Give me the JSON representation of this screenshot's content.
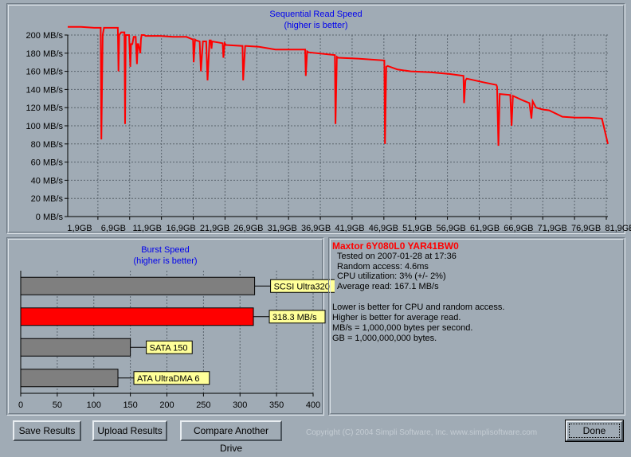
{
  "read_chart": {
    "title": "Sequential Read Speed",
    "subtitle": "(higher is better)",
    "y_ticks": [
      "200 MB/s",
      "180 MB/s",
      "160 MB/s",
      "140 MB/s",
      "120 MB/s",
      "100 MB/s",
      "80 MB/s",
      "60 MB/s",
      "40 MB/s",
      "20 MB/s",
      "0 MB/s"
    ],
    "x_ticks": [
      "1,9GB",
      "6,9GB",
      "11,9GB",
      "16,9GB",
      "21,9GB",
      "26,9GB",
      "31,9GB",
      "36,9GB",
      "41,9GB",
      "46,9GB",
      "51,9GB",
      "56,9GB",
      "61,9GB",
      "66,9GB",
      "71,9GB",
      "76,9GB",
      "81,9GB"
    ]
  },
  "burst_chart": {
    "title": "Burst Speed",
    "subtitle": "(higher is better)",
    "x_ticks": [
      "0",
      "50",
      "100",
      "150",
      "200",
      "250",
      "300",
      "350",
      "400"
    ],
    "bars": [
      {
        "label": "SCSI Ultra320",
        "highlight": false
      },
      {
        "label": "318.3 MB/s",
        "highlight": true
      },
      {
        "label": "SATA 150",
        "highlight": false
      },
      {
        "label": "ATA UltraDMA 6",
        "highlight": false
      }
    ]
  },
  "info": {
    "drive_name": "Maxtor 6Y080L0 YAR41BW0",
    "tested_on": "Tested on 2007-01-28 at 17:36",
    "random_access": "Random access: 4.6ms",
    "cpu_utilization": "CPU utilization: 3% (+/- 2%)",
    "average_read": "Average read: 167.1 MB/s",
    "note1": "Lower is better for CPU and random access.",
    "note2": "Higher is better for average read.",
    "note3": "MB/s = 1,000,000 bytes per second.",
    "note4": "GB = 1,000,000,000 bytes."
  },
  "buttons": {
    "save": "Save Results",
    "upload": "Upload Results",
    "compare": "Compare Another Drive",
    "done": "Done"
  },
  "copyright": "Copyright (C) 2004 Simpli Software, Inc. www.simplisoftware.com",
  "colors": {
    "background": "#a0abb5",
    "series": "#ff0000",
    "title": "#0000ee",
    "drive_name": "#ff0000",
    "bar_default": "#7f7f7f",
    "bar_highlight": "#ff0000",
    "label_bg": "#ffff99"
  },
  "chart_data": [
    {
      "type": "line",
      "title": "Sequential Read Speed",
      "subtitle": "(higher is better)",
      "xlabel": "",
      "ylabel": "",
      "y_unit": "MB/s",
      "x_unit": "GB",
      "xlim": [
        0,
        81.9
      ],
      "ylim": [
        0,
        200
      ],
      "grid": true,
      "series": [
        {
          "x": [
            0,
            2,
            4,
            5,
            5.1,
            5.3,
            5.5,
            6.6,
            7.0,
            7.6,
            7.7,
            7.8,
            8.1,
            8.3,
            8.6,
            8.7,
            8.8,
            9.1,
            9.3,
            9.5,
            9.6,
            9.8,
            10,
            10.3,
            10.5,
            10.6,
            10.7,
            11.0,
            11.1,
            11.2,
            11.6,
            11.8,
            12,
            12.5,
            14,
            16,
            18,
            19,
            19.1,
            19.3,
            19.5,
            20,
            20.2,
            20.5,
            20.7,
            21,
            21.2,
            21.5,
            21.7,
            21.8,
            21.9,
            23.5,
            23.6,
            23.8,
            24.0,
            26.5,
            26.6,
            26.9,
            27.1,
            29.0,
            31.5,
            36.0,
            36.1,
            36.3,
            36.5,
            40.5,
            40.6,
            40.8,
            41.0,
            44.0,
            48.0,
            48.1,
            48.3,
            48.5,
            50.0,
            52.0,
            55.0,
            58.0,
            60.0,
            60.1,
            60.3,
            60.5,
            63.0,
            65.0,
            65.1,
            65.3,
            65.5,
            67.0,
            67.1,
            67.3,
            67.5,
            69.0,
            70.0,
            70.3,
            70.5,
            71.0,
            72.0,
            73.0,
            75.0,
            77.0,
            79.0,
            81.0,
            81.9
          ],
          "y": [
            209,
            209,
            208,
            208,
            85,
            200,
            208,
            208,
            208,
            208,
            160,
            200,
            203,
            203,
            203,
            102,
            200,
            200,
            200,
            165,
            190,
            190,
            198,
            198,
            168,
            190,
            190,
            180,
            195,
            200,
            200,
            199,
            199,
            199,
            199,
            198,
            198,
            195,
            170,
            195,
            194,
            193,
            160,
            193,
            193,
            193,
            150,
            194,
            194,
            185,
            193,
            191,
            175,
            191,
            189,
            188,
            150,
            188,
            188,
            187,
            184,
            184,
            155,
            182,
            181,
            178,
            102,
            176,
            175,
            174,
            172,
            80,
            165,
            166,
            162,
            160,
            159,
            157,
            155,
            125,
            150,
            152,
            148,
            145,
            143,
            78,
            135,
            134,
            134,
            100,
            133,
            128,
            125,
            108,
            127,
            120,
            118,
            117,
            110,
            109,
            109,
            108,
            80
          ]
        }
      ]
    },
    {
      "type": "bar",
      "title": "Burst Speed",
      "subtitle": "(higher is better)",
      "orientation": "horizontal",
      "xlim": [
        0,
        400
      ],
      "grid": true,
      "categories": [
        "SCSI Ultra320",
        "318.3 MB/s",
        "SATA 150",
        "ATA UltraDMA 6"
      ],
      "values": [
        320,
        318.3,
        150,
        133
      ]
    }
  ]
}
